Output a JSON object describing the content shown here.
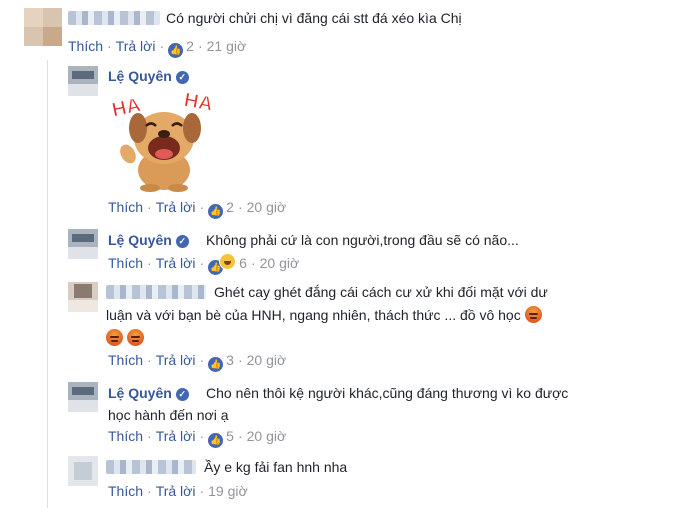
{
  "actions": {
    "like": "Thích",
    "reply": "Trả lời",
    "separator": "·"
  },
  "author": {
    "name": "Lệ Quyên",
    "verified_mark": "✓"
  },
  "comments": [
    {
      "text": "Có người chửi chị vì đăng cái stt đá xéo kìa Chị",
      "reactions": "2",
      "time": "21 giờ"
    },
    {
      "sticker_text_left": "HA",
      "sticker_text_right": "HA",
      "reactions": "2",
      "time": "20 giờ"
    },
    {
      "text": "Không phải cứ là con người,trong đầu sẽ có não...",
      "reactions": "6",
      "time": "20 giờ"
    },
    {
      "text_line1": "Ghét cay ghét đắng cái cách cư xử khi đối mặt với dư",
      "text_line2": "luận và với bạn bè của HNH, ngang nhiên, thách thức ... đồ vô học",
      "reactions": "3",
      "time": "20 giờ"
    },
    {
      "text_line1": "Cho nên thôi kệ người khác,cũng đáng thương vì ko được",
      "text_line2": "học hành đến nơi ạ",
      "reactions": "5",
      "time": "20 giờ"
    },
    {
      "text": "Ầy e kg fải fan hnh nha",
      "time": "19 giờ"
    }
  ],
  "icons": {
    "like": "thumbs-up-icon",
    "haha": "haha-reaction-icon",
    "angry": "angry-reaction-icon",
    "verified": "verified-badge-icon"
  },
  "colors": {
    "link": "#365899",
    "meta": "#90949c",
    "like_blue": "#4267b2"
  }
}
